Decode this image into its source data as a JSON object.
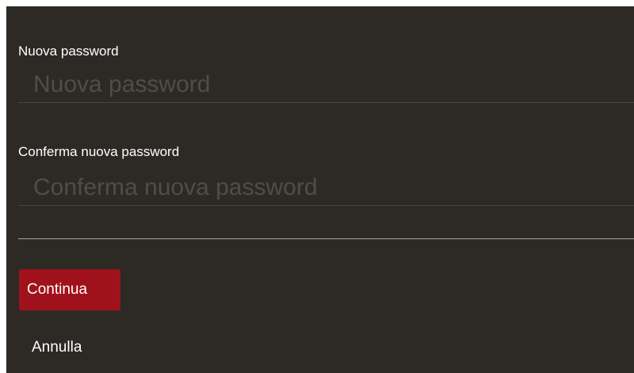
{
  "form": {
    "new_password": {
      "label": "Nuova password",
      "placeholder": "Nuova password",
      "value": ""
    },
    "confirm_password": {
      "label": "Conferma nuova password",
      "placeholder": "Conferma nuova password",
      "value": ""
    },
    "continue_label": "Continua",
    "cancel_label": "Annulla",
    "colors": {
      "background": "#2d2a26",
      "primary_button": "#a0121b",
      "text": "#ffffff",
      "placeholder": "#4f4d4a"
    }
  }
}
